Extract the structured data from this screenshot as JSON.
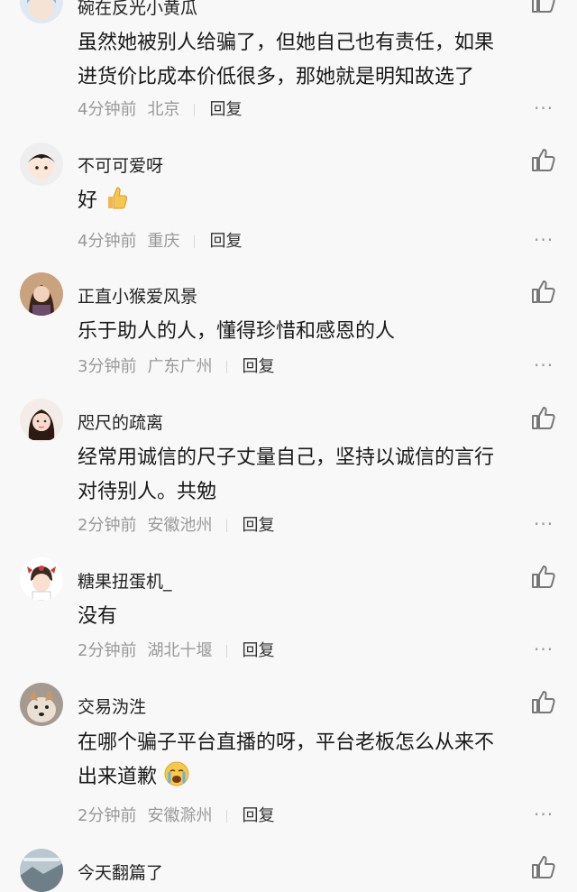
{
  "comments": [
    {
      "username": "碗在反光小黄瓜",
      "lines": [
        "虽然她被别人给骗了，但她自己也有责任，如果",
        "进货价比成本价低很多，那她就是明知故选了"
      ],
      "time": "4分钟前",
      "location": "北京",
      "reply_label": "回复",
      "avatar_icon": "avatar-girl-cartoon"
    },
    {
      "username": "不可可爱呀",
      "lines": [
        "好"
      ],
      "emoji": "thumbs-up-emoji",
      "time": "4分钟前",
      "location": "重庆",
      "reply_label": "回复",
      "avatar_icon": "avatar-boy-cartoon"
    },
    {
      "username": "正直小猴爱风景",
      "lines": [
        "乐于助人的人，懂得珍惜和感恩的人"
      ],
      "time": "3分钟前",
      "location": "广东广州",
      "reply_label": "回复",
      "avatar_icon": "avatar-woman-photo"
    },
    {
      "username": "咫尺的疏离",
      "lines": [
        "经常用诚信的尺子丈量自己，坚持以诚信的言行",
        "对待别人。共勉"
      ],
      "time": "2分钟前",
      "location": "安徽池州",
      "reply_label": "回复",
      "avatar_icon": "avatar-girl-photo"
    },
    {
      "username": "糖果扭蛋机_",
      "lines": [
        "没有"
      ],
      "time": "2分钟前",
      "location": "湖北十堰",
      "reply_label": "回复",
      "avatar_icon": "avatar-cartoon-bow"
    },
    {
      "username": "交易沩泩",
      "lines": [
        "在哪个骗子平台直播的呀，平台老板怎么从来不",
        "出来道歉"
      ],
      "emoji": "crying-face-emoji",
      "time": "2分钟前",
      "location": "安徽滁州",
      "reply_label": "回复",
      "avatar_icon": "avatar-dog-photo"
    },
    {
      "username": "今天翻篇了",
      "avatar_icon": "avatar-scenery-photo"
    }
  ],
  "more_label": "···",
  "colors": {
    "background": "#f8f8f8",
    "meta": "#999999",
    "text": "#1a1a1a"
  }
}
